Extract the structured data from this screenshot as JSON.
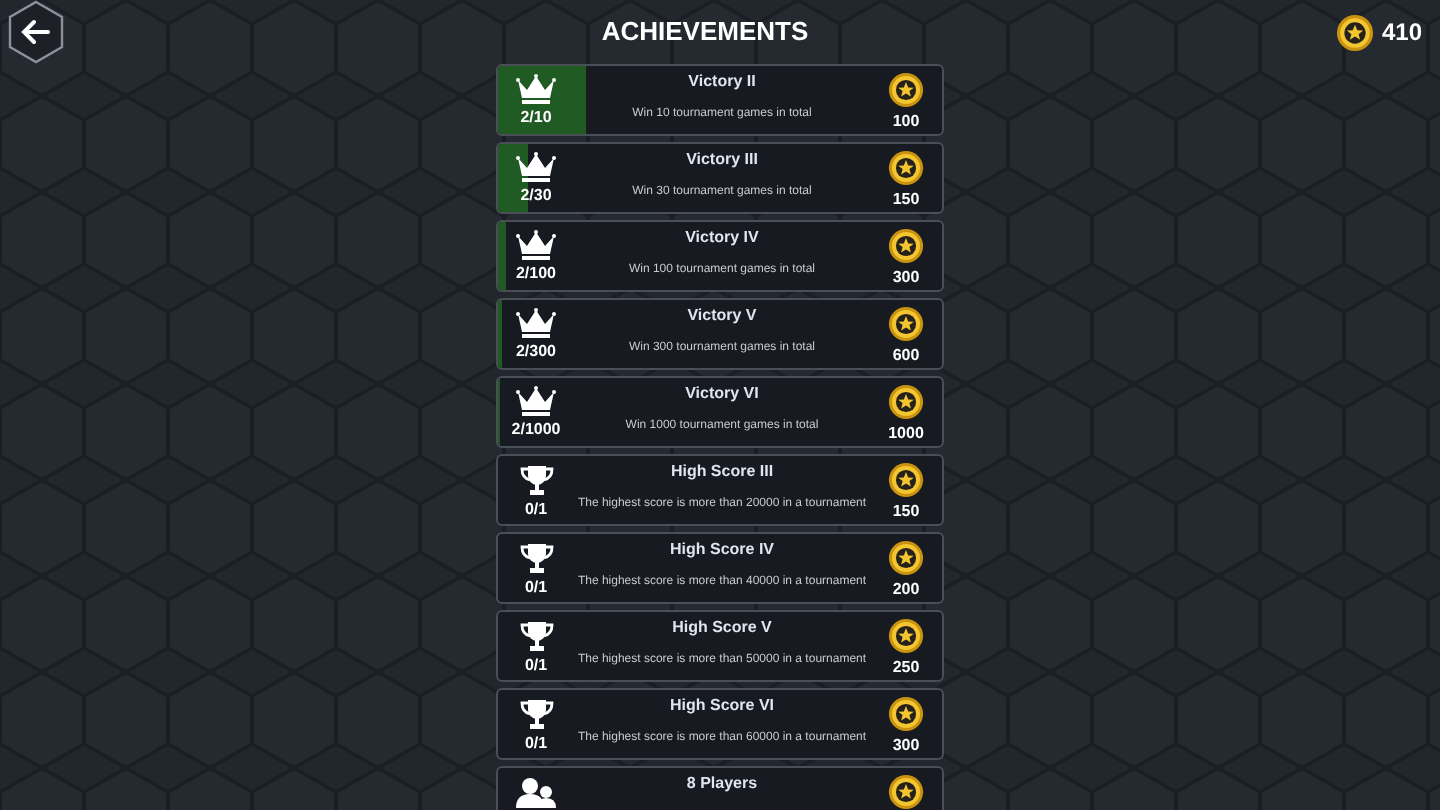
{
  "header": {
    "title": "ACHIEVEMENTS",
    "coins": "410"
  },
  "achievements": [
    {
      "kind": "crown",
      "title": "Victory II",
      "description": "Win 10 tournament games in total",
      "progress": "2/10",
      "level": 0.2,
      "reward": "100"
    },
    {
      "kind": "crown",
      "title": "Victory III",
      "description": "Win 30 tournament games in total",
      "progress": "2/30",
      "level": 0.067,
      "reward": "150"
    },
    {
      "kind": "crown",
      "title": "Victory IV",
      "description": "Win 100 tournament games in total",
      "progress": "2/100",
      "level": 0.02,
      "reward": "300"
    },
    {
      "kind": "crown",
      "title": "Victory V",
      "description": "Win 300 tournament games in total",
      "progress": "2/300",
      "level": 0.007,
      "reward": "600"
    },
    {
      "kind": "crown",
      "title": "Victory VI",
      "description": "Win 1000 tournament games in total",
      "progress": "2/1000",
      "level": 0.002,
      "reward": "1000"
    },
    {
      "kind": "trophy",
      "title": "High Score III",
      "description": "The highest score is more than 20000 in a tournament",
      "progress": "0/1",
      "reward": "150"
    },
    {
      "kind": "trophy",
      "title": "High Score IV",
      "description": "The highest score is more than 40000 in a tournament",
      "progress": "0/1",
      "reward": "200"
    },
    {
      "kind": "trophy",
      "title": "High Score V",
      "description": "The highest score is more than 50000 in a tournament",
      "progress": "0/1",
      "reward": "250"
    },
    {
      "kind": "trophy",
      "title": "High Score VI",
      "description": "The highest score is more than 60000 in a tournament",
      "progress": "0/1",
      "reward": "300"
    },
    {
      "kind": "players",
      "title": "8 Players"
    }
  ]
}
